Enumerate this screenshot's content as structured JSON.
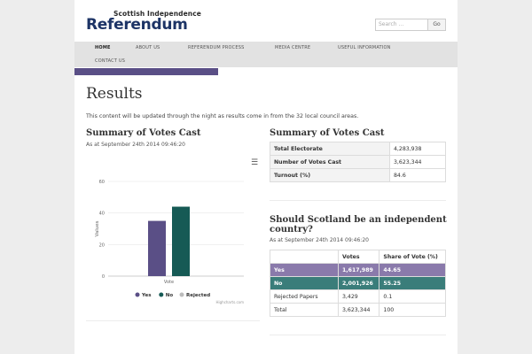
{
  "header": {
    "logo_top": "Scottish Independence",
    "logo_main": "Referendum",
    "search_placeholder": "Search ...",
    "go_label": "Go"
  },
  "nav": {
    "items": [
      "Home",
      "About Us",
      "Referendum Process",
      "Media Centre",
      "Useful Information",
      "Contact Us"
    ]
  },
  "page": {
    "title": "Results",
    "intro": "This content will be updated through the night as results come in from the 32 local council areas."
  },
  "summary": {
    "title": "Summary of Votes Cast",
    "as_at": "As at September 24th 2014 09:46:20",
    "rows": [
      {
        "label": "Total Electorate",
        "value": "4,283,938"
      },
      {
        "label": "Number of Votes Cast",
        "value": "3,623,344"
      },
      {
        "label": "Turnout (%)",
        "value": "84.6"
      }
    ]
  },
  "question": {
    "title_line1": "Should Scotland be an independent",
    "title_line2": "country?",
    "as_at": "As at September 24th 2014 09:46:20",
    "headers": [
      "",
      "Votes",
      "Share of Vote (%)"
    ],
    "rows": [
      {
        "label": "Yes",
        "votes": "1,617,989",
        "share": "44.65"
      },
      {
        "label": "No",
        "votes": "2,001,926",
        "share": "55.25"
      },
      {
        "label": "Rejected Papers",
        "votes": "3,429",
        "share": "0.1"
      },
      {
        "label": "Total",
        "votes": "3,623,344",
        "share": "100"
      }
    ]
  },
  "chart_data": {
    "type": "bar",
    "title": "Summary of Votes Cast",
    "subtitle": "As at September 24th 2014 09:46:20",
    "categories": [
      "Vote"
    ],
    "series": [
      {
        "name": "Yes",
        "values": [
          35
        ],
        "color": "#5a4f86"
      },
      {
        "name": "No",
        "values": [
          44
        ],
        "color": "#165a55"
      },
      {
        "name": "Rejected",
        "values": [
          0
        ],
        "color": "#bbbbbb"
      }
    ],
    "ylabel": "Values",
    "xlabel": "",
    "yticks": [
      "0",
      "20",
      "40",
      "60"
    ],
    "ylim": [
      0,
      60
    ],
    "legend": "bottom",
    "credits": "Highcharts.com",
    "grid": true
  }
}
